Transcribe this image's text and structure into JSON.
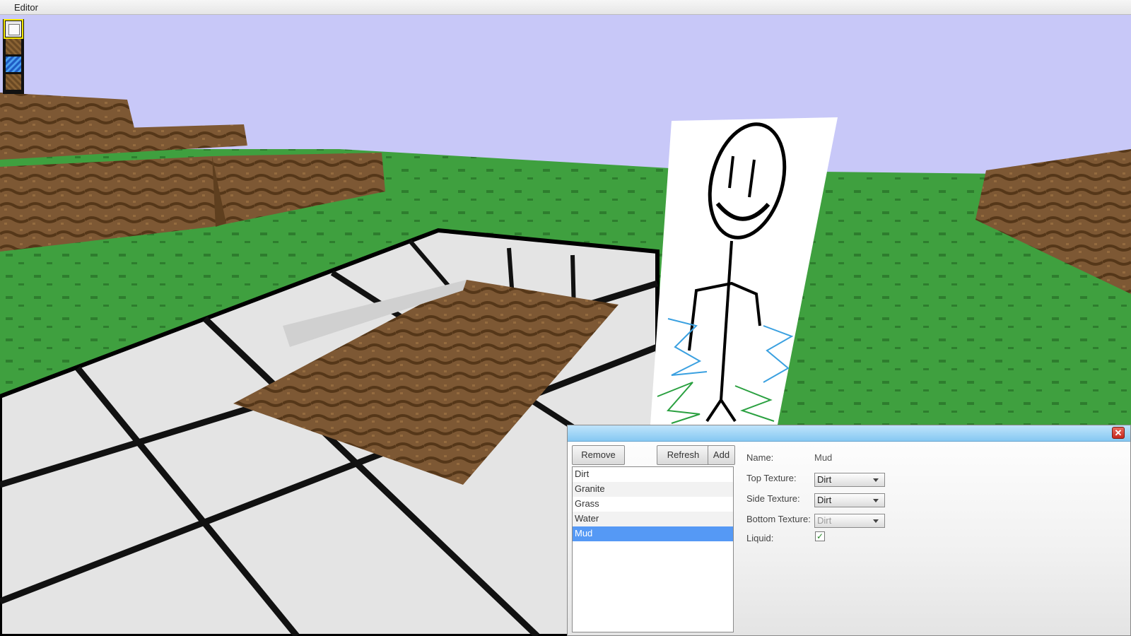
{
  "menubar": {
    "title": "Editor"
  },
  "palette": {
    "items": [
      {
        "name": "stone",
        "selected": true
      },
      {
        "name": "dirt",
        "selected": false
      },
      {
        "name": "water",
        "selected": false
      },
      {
        "name": "dirt",
        "selected": false
      }
    ]
  },
  "editor_panel": {
    "buttons": {
      "remove": "Remove",
      "refresh": "Refresh",
      "add": "Add"
    },
    "block_list": [
      "Dirt",
      "Granite",
      "Grass",
      "Water",
      "Mud"
    ],
    "selected_block": "Mud",
    "fields": {
      "name_label": "Name:",
      "name_value": "Mud",
      "top_texture_label": "Top Texture:",
      "top_texture_value": "Dirt",
      "side_texture_label": "Side Texture:",
      "side_texture_value": "Dirt",
      "bottom_texture_label": "Bottom Texture:",
      "bottom_texture_value": "Dirt",
      "liquid_label": "Liquid:",
      "liquid_checked": true
    },
    "close_icon": "close-icon"
  },
  "colors": {
    "sky": "#c8c8f8",
    "grass": "#3c9c3c",
    "dirt": "#7a5530",
    "stone": "#dcdcdc",
    "selection": "#5599f5",
    "titlebar": "#9fd4f5"
  }
}
